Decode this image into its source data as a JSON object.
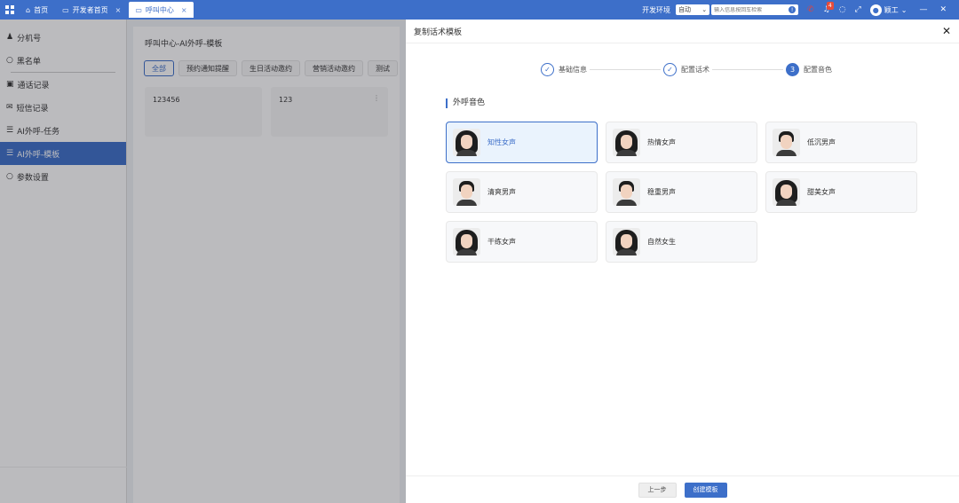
{
  "topbar": {
    "tabs": [
      {
        "label": "首页",
        "icon": "home-icon",
        "active": false,
        "closable": false
      },
      {
        "label": "开发者首页",
        "icon": "monitor-icon",
        "active": false,
        "closable": true
      },
      {
        "label": "呼叫中心",
        "icon": "monitor-icon",
        "active": true,
        "closable": true
      }
    ],
    "env_label": "开发环境",
    "env_select": "自动",
    "search_placeholder": "输入信息按回车检索",
    "badge_count": "4",
    "user_name": "颖工",
    "accent_color": "#3d6fc9"
  },
  "sidebar": {
    "items": [
      {
        "label": "分机号",
        "icon": "person-icon"
      },
      {
        "label": "黑名单",
        "icon": "circle-icon"
      },
      {
        "label": "通话记录",
        "icon": "phone-book-icon"
      },
      {
        "label": "短信记录",
        "icon": "mail-icon"
      },
      {
        "label": "AI外呼-任务",
        "icon": "list-icon"
      },
      {
        "label": "AI外呼-模板",
        "icon": "list-icon",
        "active": true
      },
      {
        "label": "参数设置",
        "icon": "circle-icon"
      }
    ]
  },
  "main": {
    "title": "呼叫中心-AI外呼-模板",
    "filters": [
      "全部",
      "预约通知提醒",
      "生日活动邀约",
      "营销活动邀约",
      "测试"
    ],
    "cards": [
      "123456",
      "123"
    ]
  },
  "dialog": {
    "title": "复制话术模板",
    "steps": [
      {
        "label": "基础信息",
        "state": "done"
      },
      {
        "label": "配置话术",
        "state": "done"
      },
      {
        "label": "配置音色",
        "state": "current",
        "number": "3"
      }
    ],
    "section_title": "外呼音色",
    "voices": [
      {
        "label": "知性女声",
        "gender": "female",
        "selected": true
      },
      {
        "label": "热情女声",
        "gender": "female"
      },
      {
        "label": "低沉男声",
        "gender": "male"
      },
      {
        "label": "清爽男声",
        "gender": "male"
      },
      {
        "label": "稳重男声",
        "gender": "male"
      },
      {
        "label": "甜美女声",
        "gender": "female"
      },
      {
        "label": "干练女声",
        "gender": "female"
      },
      {
        "label": "自然女生",
        "gender": "female"
      }
    ],
    "prev_label": "上一步",
    "create_label": "创建模板"
  }
}
